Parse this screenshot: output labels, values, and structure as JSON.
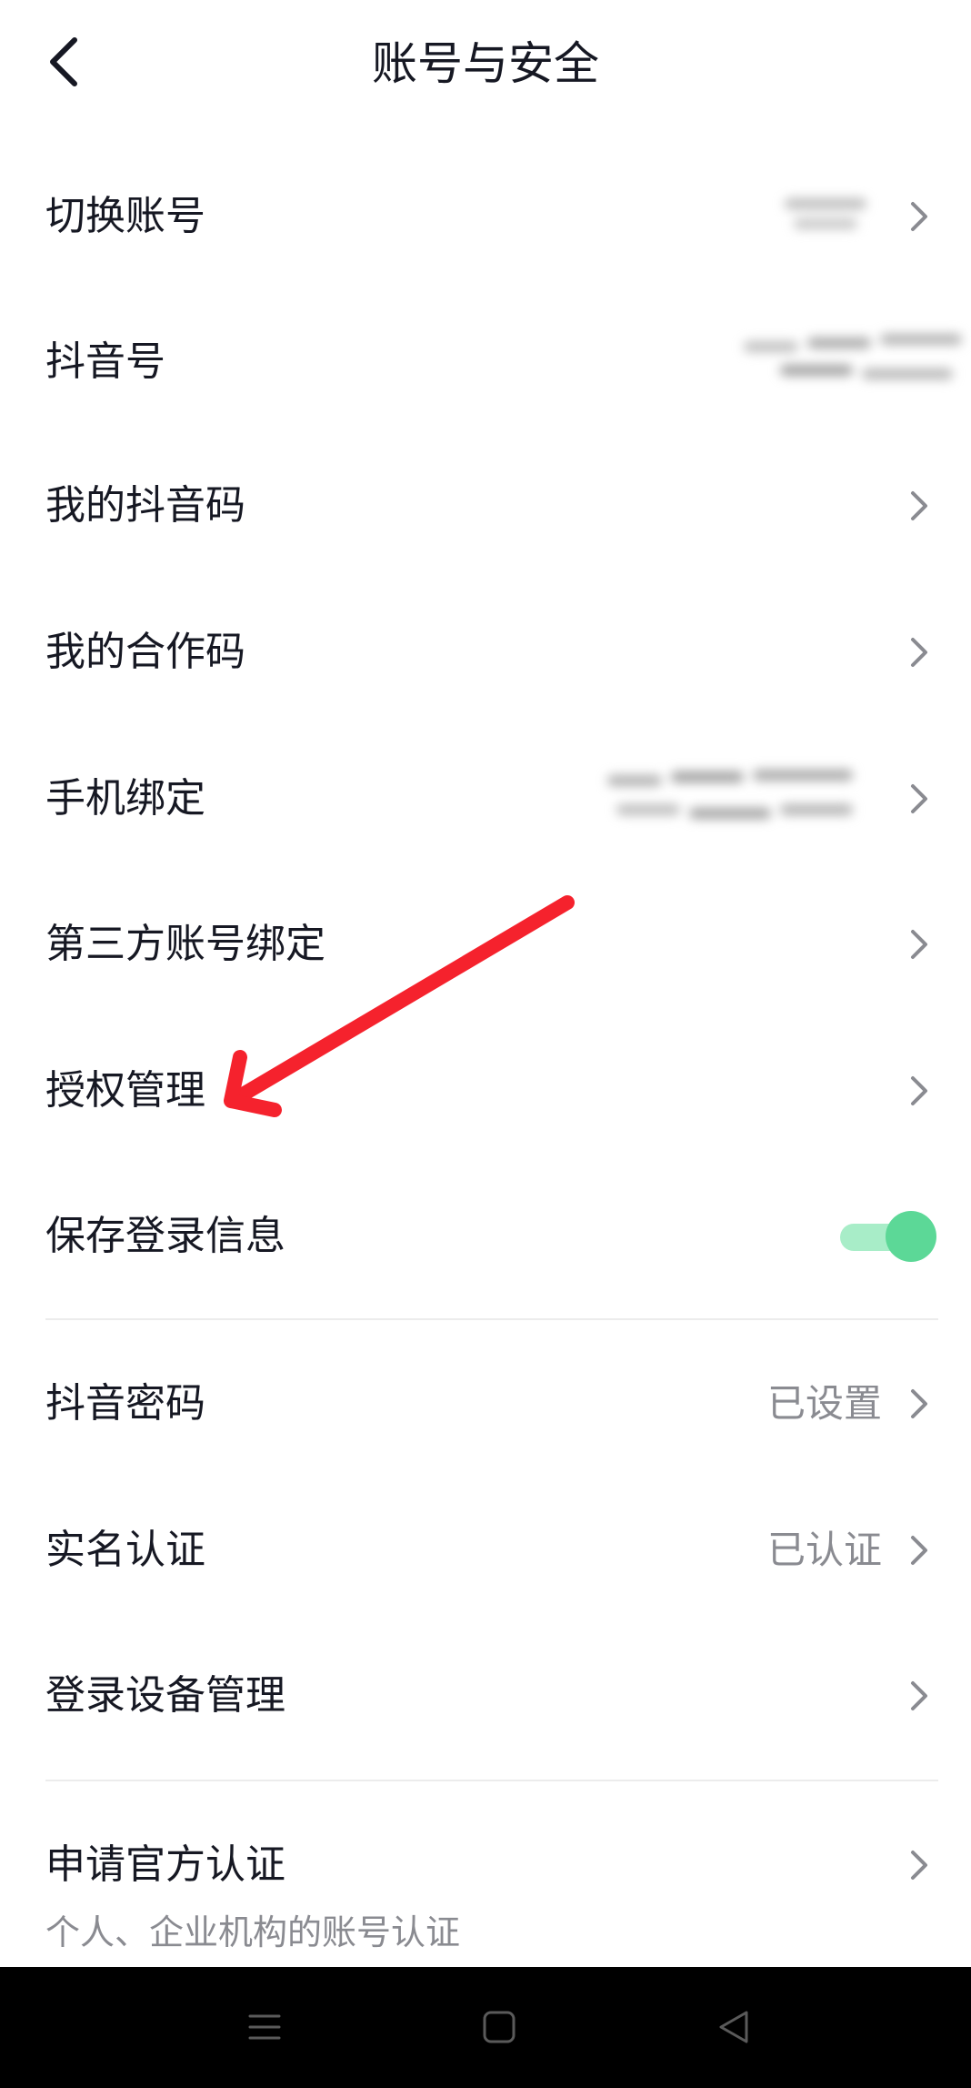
{
  "header": {
    "title": "账号与安全",
    "back_icon": "chevron-left-icon"
  },
  "rows": [
    {
      "label": "切换账号",
      "value": "",
      "chevron": true
    },
    {
      "label": "抖音号",
      "value": "",
      "chevron": false
    },
    {
      "label": "我的抖音码",
      "value": "",
      "chevron": true
    },
    {
      "label": "我的合作码",
      "value": "",
      "chevron": true
    },
    {
      "label": "手机绑定",
      "value": "",
      "chevron": true
    },
    {
      "label": "第三方账号绑定",
      "value": "",
      "chevron": true
    },
    {
      "label": "授权管理",
      "value": "",
      "chevron": true
    },
    {
      "label": "保存登录信息",
      "toggle": true,
      "toggle_state": "on"
    },
    {
      "label": "抖音密码",
      "value": "已设置",
      "chevron": true
    },
    {
      "label": "实名认证",
      "value": "已认证",
      "chevron": true
    },
    {
      "label": "登录设备管理",
      "value": "",
      "chevron": true
    },
    {
      "label": "申请官方认证",
      "sublabel": "个人、企业机构的账号认证",
      "chevron": true
    }
  ],
  "colors": {
    "text_primary": "#161823",
    "text_secondary": "#8a8b91",
    "toggle_on": "#5cd897",
    "annotation_arrow": "#f5222d"
  },
  "navbar": {
    "buttons": [
      "menu-icon",
      "home-square-icon",
      "back-triangle-icon"
    ]
  }
}
